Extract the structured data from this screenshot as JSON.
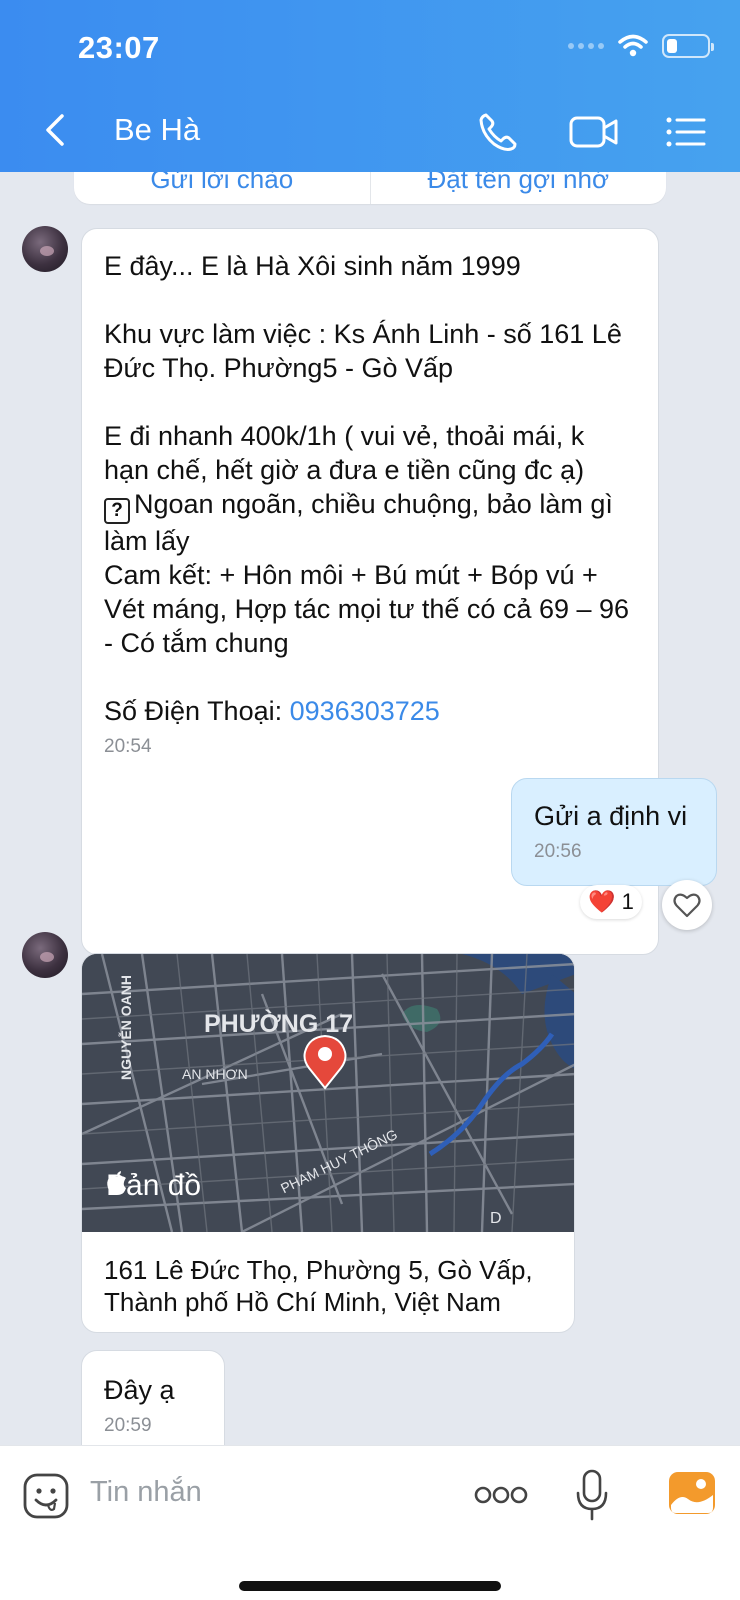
{
  "status_bar": {
    "time": "23:07",
    "battery_level": 0.25
  },
  "header": {
    "contact_name": "Be Hà"
  },
  "chips": [
    "Gửi lời chào",
    "Đặt tên gợi nhớ"
  ],
  "messages": {
    "m1": {
      "p1": "E đây... E là Hà Xôi sinh năm 1999",
      "p2": "Khu vực làm việc : Ks Ánh Linh - số 161 Lê Đức Thọ. Phường5 - Gò Vấp",
      "p3": "E đi nhanh 400k/1h ( vui vẻ, thoải mái, k hạn chế, hết giờ a đưa e tiền cũng đc ạ)",
      "p4_mark": "?",
      "p4": "Ngoan ngoãn, chiều chuộng, bảo làm gì làm lấy",
      "p5": "Cam kết: + Hôn môi + Bú mút + Bóp vú + Vét máng, Hợp tác mọi tư thế có cả 69 – 96 - Có tắm chung",
      "phone_label": "Số Điện Thoại: ",
      "phone": "0936303725",
      "time": "20:54"
    },
    "m2": {
      "text": "Gửi a định vi",
      "time": "20:56",
      "reaction_emoji": "❤️",
      "reaction_count": "1"
    },
    "map": {
      "labels": [
        "PHƯỜNG 17",
        "NGUYỄN OANH",
        "AN NHƠN",
        "PHAM HUY THÔNG",
        "D"
      ],
      "brand": "Bản đồ",
      "address": "161 Lê Đức Thọ, Phường 5, Gò Vấp, Thành phố Hồ Chí Minh, Việt Nam"
    },
    "m3": {
      "text": "Đây ạ",
      "time": "20:59"
    }
  },
  "input": {
    "placeholder": "Tin nhắn"
  },
  "colors": {
    "accent": "#3b8ae8",
    "header": "#46a2ef",
    "outgoing_bubble": "#d9efff",
    "map_pin": "#e5483b"
  }
}
